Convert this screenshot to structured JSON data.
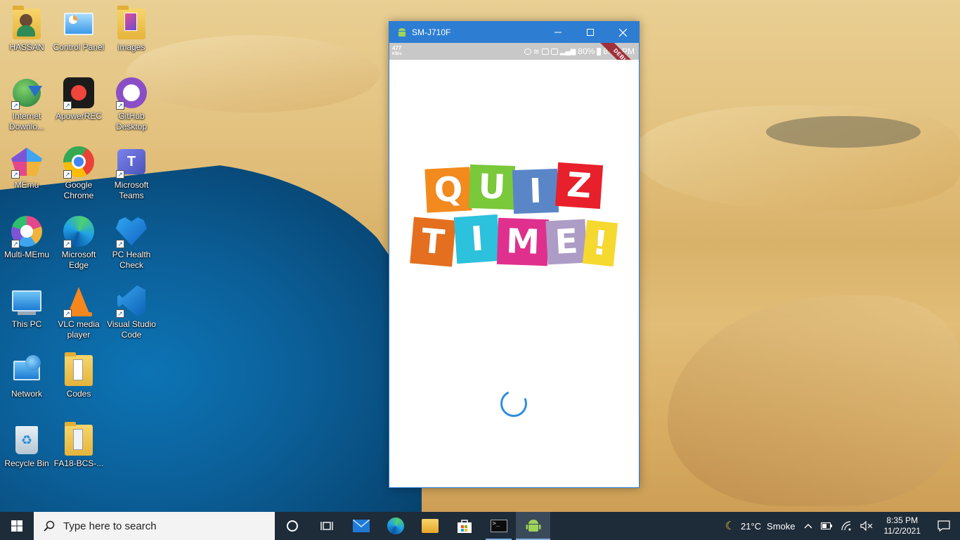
{
  "desktop": {
    "icons": [
      {
        "label": "HASSAN"
      },
      {
        "label": "Control Panel"
      },
      {
        "label": "images"
      },
      {
        "label": "Internet Downlo..."
      },
      {
        "label": "ApowerREC"
      },
      {
        "label": "GitHub Desktop"
      },
      {
        "label": "MEmu"
      },
      {
        "label": "Google Chrome"
      },
      {
        "label": "Microsoft Teams"
      },
      {
        "label": "Multi-MEmu"
      },
      {
        "label": "Microsoft Edge"
      },
      {
        "label": "PC Health Check"
      },
      {
        "label": "This PC"
      },
      {
        "label": "VLC media player"
      },
      {
        "label": "Visual Studio Code"
      },
      {
        "label": "Network"
      },
      {
        "label": "Codes"
      },
      {
        "label": "Recycle Bin"
      },
      {
        "label": "FA18-BCS-..."
      }
    ]
  },
  "emulator": {
    "title": "SM-J710F",
    "statusbar": {
      "speed_top": "477",
      "speed_bottom": "KB/s",
      "battery": "80%",
      "time": "8:35 PM"
    },
    "debug_banner": "DEBUG",
    "logo": {
      "row1": [
        {
          "letter": "Q",
          "color": "#f28a1e"
        },
        {
          "letter": "U",
          "color": "#79c93a"
        },
        {
          "letter": "I",
          "color": "#5a86c8"
        },
        {
          "letter": "Z",
          "color": "#e8202b"
        }
      ],
      "row2": [
        {
          "letter": "T",
          "color": "#e46f1f"
        },
        {
          "letter": "I",
          "color": "#2cc1dc"
        },
        {
          "letter": "M",
          "color": "#e0308e"
        },
        {
          "letter": "E",
          "color": "#ad9cc6"
        },
        {
          "letter": "!",
          "color": "#f6d92e"
        }
      ]
    },
    "loading": true
  },
  "taskbar": {
    "search_placeholder": "Type here to search",
    "apps": [
      "cortana-icon",
      "task-view-icon",
      "mail-icon",
      "edge-icon",
      "file-explorer-icon",
      "store-icon",
      "terminal-icon",
      "android-emulator-icon"
    ],
    "weather": {
      "temp": "21°C",
      "condition": "Smoke"
    },
    "clock": {
      "time": "8:35 PM",
      "date": "11/2/2021"
    }
  }
}
